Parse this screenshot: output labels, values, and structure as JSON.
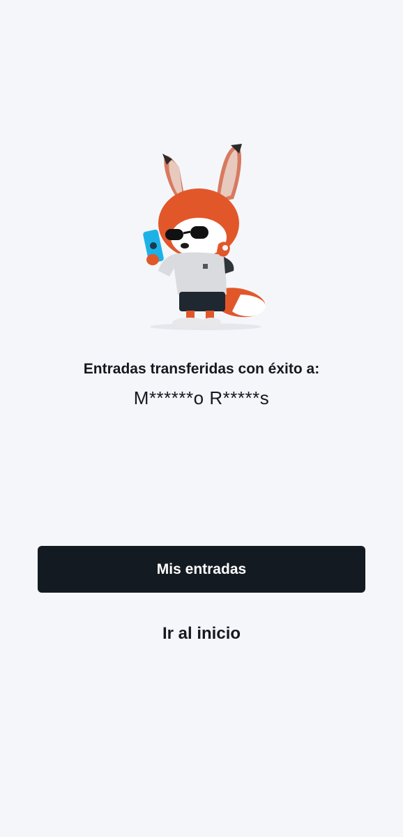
{
  "illustration": {
    "name": "fox-mascot-with-phone-illustration"
  },
  "confirmation": {
    "message": "Entradas transferidas con éxito a:",
    "recipient": "M******o R*****s"
  },
  "actions": {
    "primary_label": "Mis entradas",
    "secondary_label": "Ir al inicio"
  },
  "colors": {
    "background": "#f5f6fa",
    "primary_button": "#141a21",
    "text": "#15191f"
  }
}
